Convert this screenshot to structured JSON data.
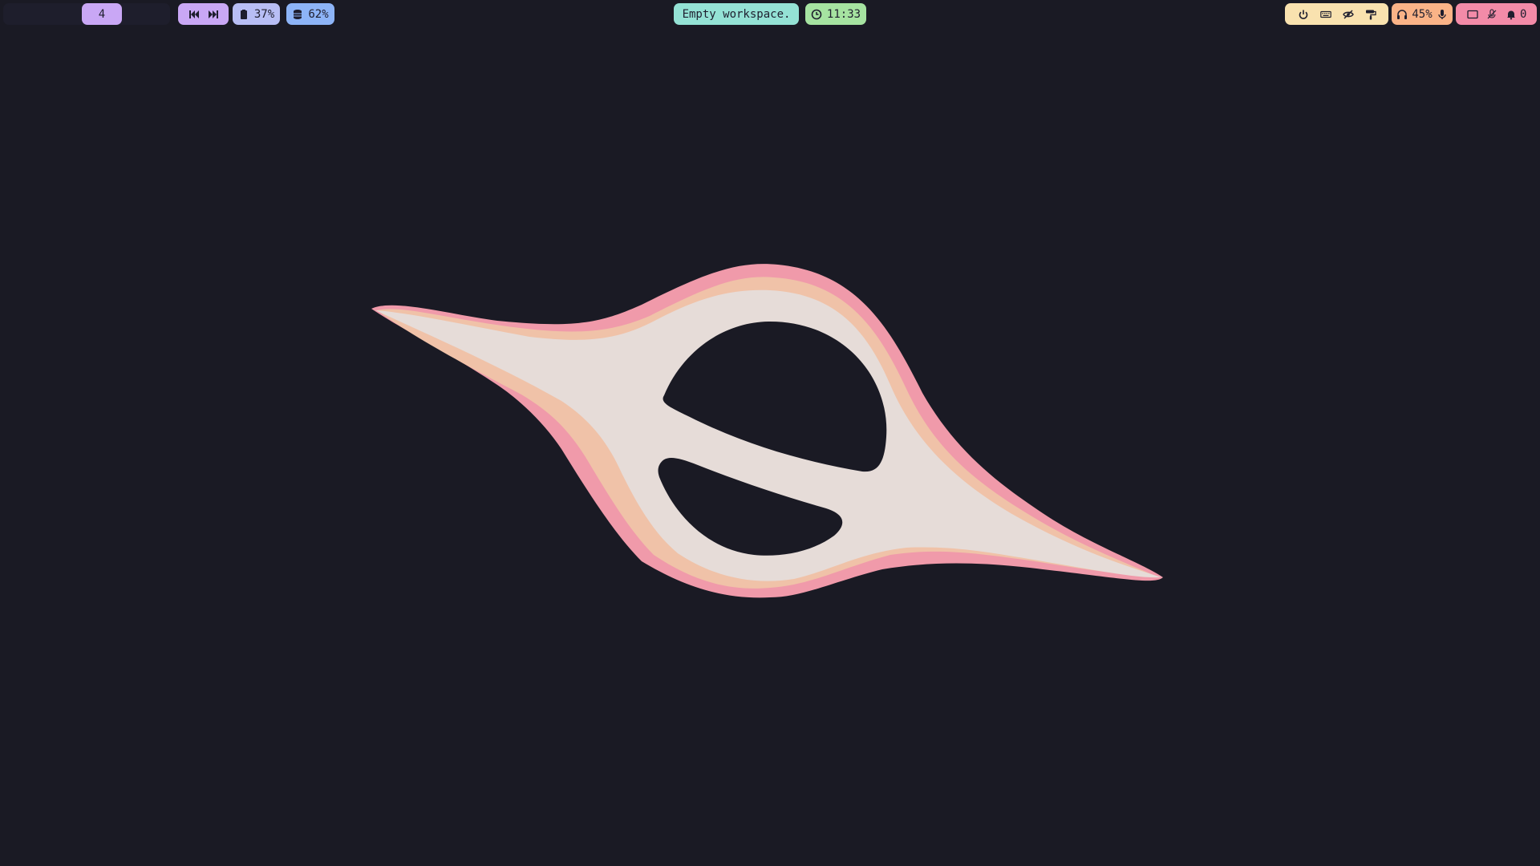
{
  "workspaces": {
    "active_label": "4"
  },
  "media": {
    "prev_icon": "skip-previous-icon",
    "next_icon": "skip-next-icon"
  },
  "battery": {
    "icon": "battery-icon",
    "value": "37%"
  },
  "disk": {
    "icon": "database-icon",
    "value": "62%"
  },
  "window": {
    "title": "Empty workspace."
  },
  "clock": {
    "icon": "clock-icon",
    "time": "11:33"
  },
  "tray": {
    "icons": [
      "power-icon",
      "keyboard-icon",
      "eye-off-icon",
      "paint-roller-icon"
    ]
  },
  "audio": {
    "icon": "headphones-icon",
    "volume": "45%",
    "mic_icon": "microphone-icon"
  },
  "notifications": {
    "icons": [
      "screen-icon",
      "mic-off-icon",
      "bell-icon"
    ],
    "count": "0"
  },
  "colors": {
    "background": "#1a1a24",
    "workspace": "#c9a7f5",
    "battery": "#b8bef5",
    "disk": "#8db4f7",
    "window_title": "#94e2d5",
    "clock": "#a6e3a1",
    "tray": "#f9e2af",
    "audio": "#fab387",
    "notifications": "#f38ba8",
    "logo_outer": "#f09aaa",
    "logo_middle": "#f0c2a8",
    "logo_inner": "#e6dcd8"
  }
}
